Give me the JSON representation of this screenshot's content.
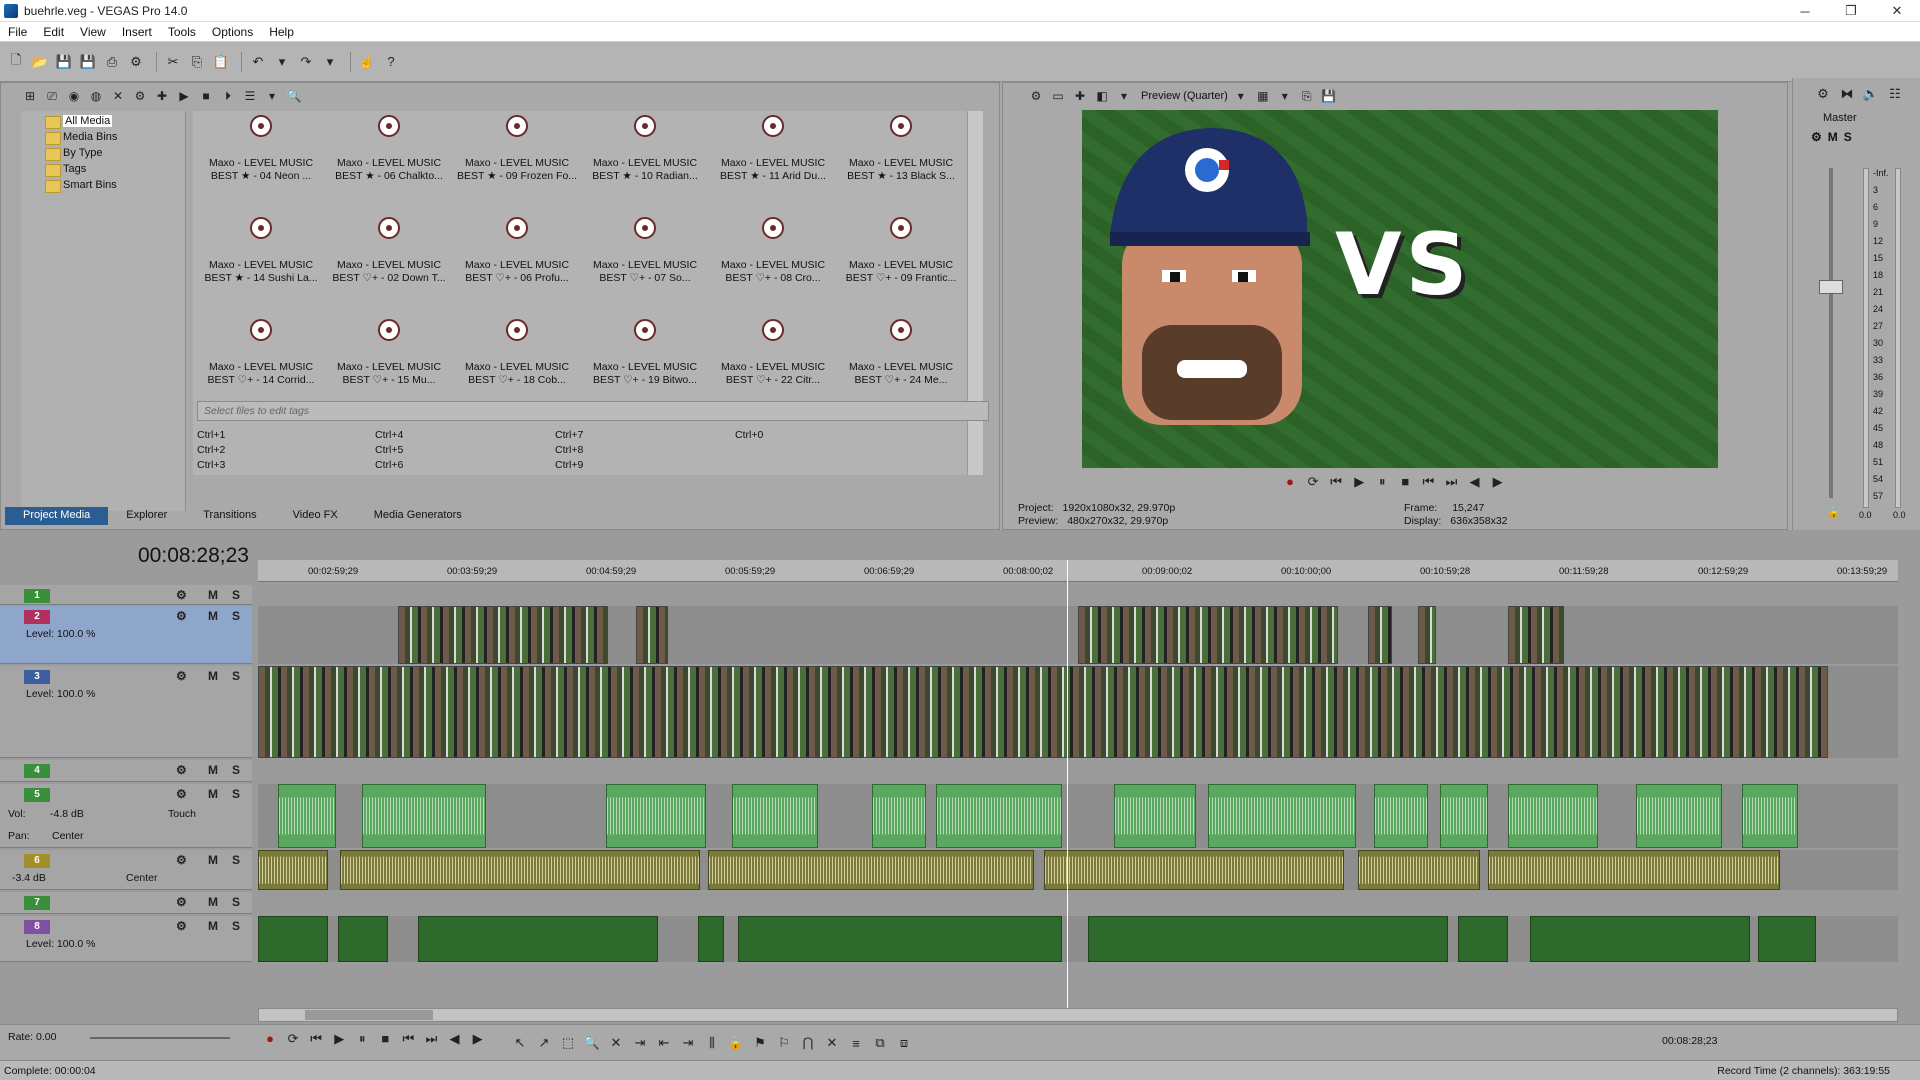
{
  "window": {
    "title": "buehrle.veg - VEGAS Pro 14.0"
  },
  "window_controls": {
    "minimize": "─",
    "maximize": "❐",
    "close": "✕"
  },
  "menu": [
    "File",
    "Edit",
    "View",
    "Insert",
    "Tools",
    "Options",
    "Help"
  ],
  "media_tree": [
    "All Media",
    "Media Bins",
    "By Type",
    "Tags",
    "Smart Bins"
  ],
  "media_items": [
    [
      "Maxo - LEVEL MUSIC",
      "BEST ★ - 04 Neon ..."
    ],
    [
      "Maxo - LEVEL MUSIC",
      "BEST ★ - 06 Chalkto..."
    ],
    [
      "Maxo - LEVEL MUSIC",
      "BEST ★ - 09 Frozen Fo..."
    ],
    [
      "Maxo - LEVEL MUSIC",
      "BEST ★ - 10 Radian..."
    ],
    [
      "Maxo - LEVEL MUSIC",
      "BEST ★ - 11 Arid Du..."
    ],
    [
      "Maxo - LEVEL MUSIC",
      "BEST ★ - 13 Black S..."
    ],
    [
      "Maxo - LEVEL MUSIC",
      "BEST ★ - 14 Sushi La..."
    ],
    [
      "Maxo - LEVEL MUSIC",
      "BEST ♡+ - 02 Down T..."
    ],
    [
      "Maxo - LEVEL MUSIC",
      "BEST ♡+ - 06 Profu..."
    ],
    [
      "Maxo - LEVEL MUSIC",
      "BEST ♡+ - 07 So..."
    ],
    [
      "Maxo - LEVEL MUSIC",
      "BEST ♡+ - 08 Cro..."
    ],
    [
      "Maxo - LEVEL MUSIC",
      "BEST ♡+ - 09 Frantic..."
    ],
    [
      "Maxo - LEVEL MUSIC",
      "BEST ♡+ - 14 Corrid..."
    ],
    [
      "Maxo - LEVEL MUSIC",
      "BEST ♡+ - 15 Mu..."
    ],
    [
      "Maxo - LEVEL MUSIC",
      "BEST ♡+ - 18 Cob..."
    ],
    [
      "Maxo - LEVEL MUSIC",
      "BEST ♡+ - 19 Bitwo..."
    ],
    [
      "Maxo - LEVEL MUSIC",
      "BEST ♡+ - 22 Citr..."
    ],
    [
      "Maxo - LEVEL MUSIC",
      "BEST ♡+ - 24 Me..."
    ]
  ],
  "tags_placeholder": "Select files to edit tags",
  "shortcuts": [
    "Ctrl+1",
    "Ctrl+2",
    "Ctrl+3",
    "Ctrl+4",
    "Ctrl+5",
    "Ctrl+6",
    "Ctrl+7",
    "Ctrl+8",
    "Ctrl+9",
    "Ctrl+0"
  ],
  "tabs": [
    "Project Media",
    "Explorer",
    "Transitions",
    "Video FX",
    "Media Generators"
  ],
  "preview": {
    "mode": "Preview (Quarter)",
    "vs_text": "VS",
    "project_label": "Project:",
    "project_value": "1920x1080x32, 29.970p",
    "preview_label": "Preview:",
    "preview_value": "480x270x32, 29.970p",
    "frame_label": "Frame:",
    "frame_value": "15,247",
    "display_label": "Display:",
    "display_value": "636x358x32"
  },
  "mixer": {
    "title": "Master",
    "scale": [
      "-Inf.",
      "3",
      "6",
      "9",
      "12",
      "15",
      "18",
      "21",
      "24",
      "27",
      "30",
      "33",
      "36",
      "39",
      "42",
      "45",
      "48",
      "51",
      "54",
      "57"
    ],
    "readout_left": "0.0",
    "readout_right": "0.0"
  },
  "timecode": "00:08:28;23",
  "ruler_marks": [
    "00:02:59;29",
    "00:03:59;29",
    "00:04:59;29",
    "00:05:59;29",
    "00:06:59;29",
    "00:08:00;02",
    "00:09:00;02",
    "00:10:00;00",
    "00:10:59;28",
    "00:11:59;28",
    "00:12:59;29",
    "00:13:59;29"
  ],
  "tracks": [
    {
      "num": "1",
      "type": "video",
      "level": ""
    },
    {
      "num": "2",
      "type": "video",
      "level": "Level: 100.0 %"
    },
    {
      "num": "3",
      "type": "video",
      "level": "Level: 100.0 %"
    },
    {
      "num": "4",
      "type": "audio",
      "level": ""
    },
    {
      "num": "5",
      "type": "audio",
      "vol": "Vol:",
      "vol_value": "-4.8 dB",
      "touch": "Touch",
      "pan": "Pan:",
      "pan_value": "Center"
    },
    {
      "num": "6",
      "type": "audio",
      "vol_value": "-3.4 dB",
      "pan_value": "Center"
    },
    {
      "num": "7",
      "type": "audio",
      "level": ""
    },
    {
      "num": "8",
      "type": "video",
      "level": "Level: 100.0 %"
    }
  ],
  "track_buttons": {
    "mute": "M",
    "solo": "S"
  },
  "meter_labels": [
    "12",
    "24",
    "36",
    "48"
  ],
  "meter_labels_6": [
    "18",
    "36",
    "54"
  ],
  "meter_inf": "-Inf.",
  "rate": "Rate: 0.00",
  "end_timecode": "00:08:28;23",
  "status": {
    "complete": "Complete: 00:00:04",
    "record_time": "Record Time (2 channels): 363:19:55"
  }
}
